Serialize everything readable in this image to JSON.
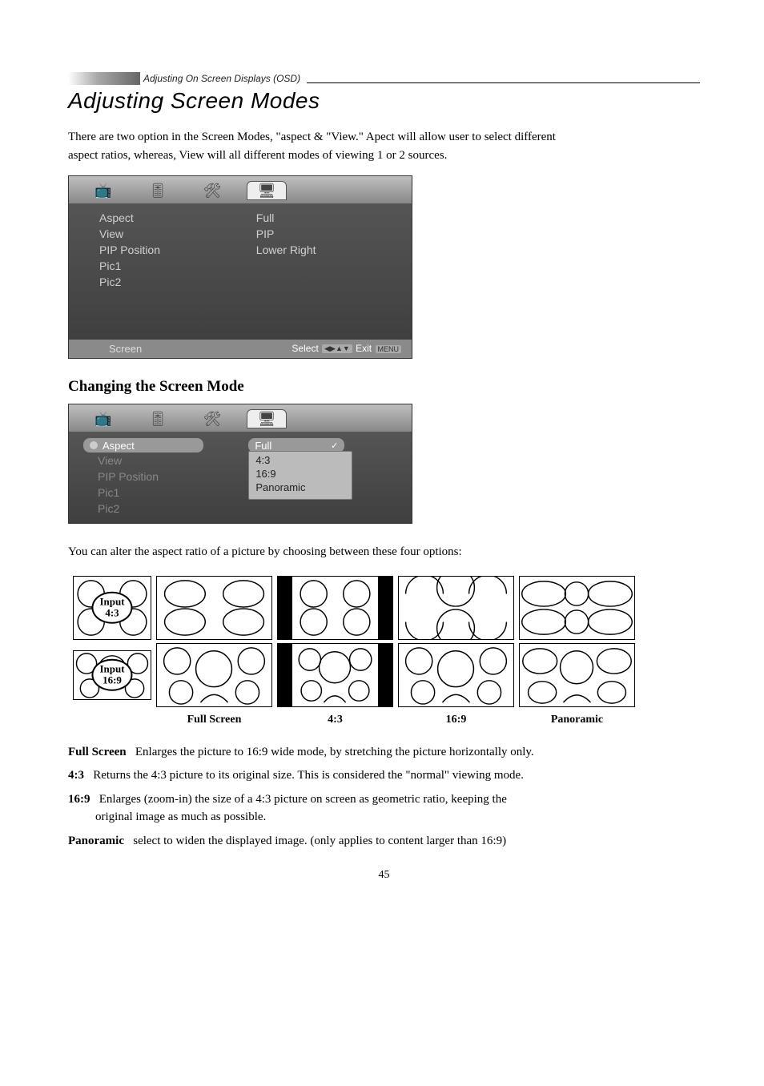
{
  "header": {
    "breadcrumb": "Adjusting On Screen Displays (OSD)",
    "title": "Adjusting Screen Modes"
  },
  "intro": "There are two option in the Screen Modes, \"aspect & \"View.\" Apect will allow user to select different aspect ratios, whereas, View will all different modes of viewing 1 or 2 sources.",
  "osd1": {
    "items": [
      "Aspect",
      "View",
      "PIP Position",
      "Pic1",
      "Pic2"
    ],
    "values": [
      "Full",
      "PIP",
      "Lower Right"
    ],
    "footer_label": "Screen",
    "footer_select": "Select",
    "footer_exit": "Exit",
    "footer_menu": "MENU"
  },
  "subheading": "Changing the Screen Mode",
  "osd2": {
    "items": [
      "Aspect",
      "View",
      "PIP Position",
      "Pic1",
      "Pic2"
    ],
    "selected": "Full",
    "dropdown": [
      "4:3",
      "16:9",
      "Panoramic"
    ]
  },
  "caption": "You can alter the aspect ratio of a picture by choosing between these four options:",
  "ratio": {
    "row1_label": "Input\n4:3",
    "row2_label": "Input\n16:9",
    "cols": [
      "Full Screen",
      "4:3",
      "16:9",
      "Panoramic"
    ]
  },
  "definitions": {
    "fullscreen_term": "Full Screen",
    "fullscreen_text": "Enlarges the picture to 16:9 wide mode, by stretching the picture horizontally only.",
    "four_three_term": "4:3",
    "four_three_text": "Returns the 4:3 picture to its original size. This is considered the \"normal\" viewing mode.",
    "sixteen_nine_term": "16:9",
    "sixteen_nine_text": "Enlarges (zoom-in) the size of a 4:3 picture on screen as geometric ratio, keeping the original image as much as possible.",
    "panoramic_term": "Panoramic",
    "panoramic_text": "select to widen the displayed image. (only applies to content larger than 16:9)"
  },
  "page_number": "45"
}
